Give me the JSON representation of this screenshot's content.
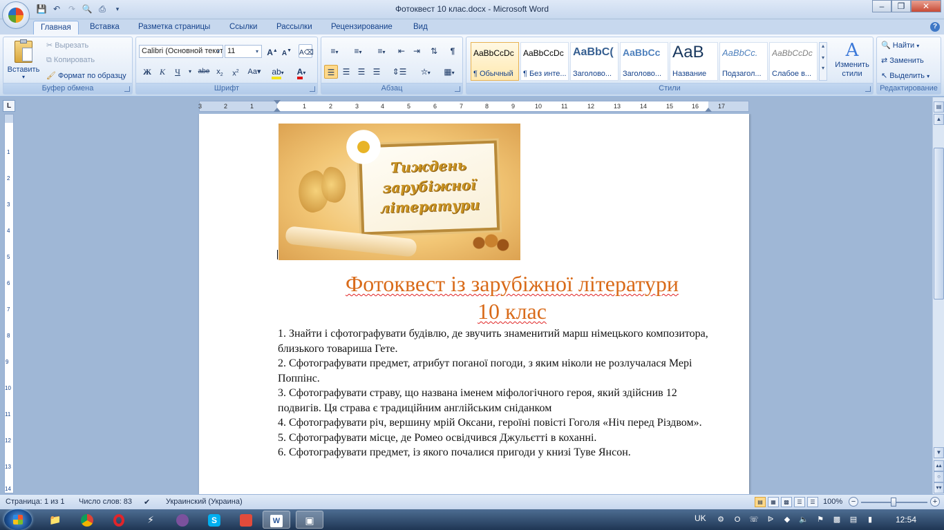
{
  "window": {
    "title": "Фотоквест 10 клас.docx - Microsoft Word"
  },
  "tabs": [
    "Главная",
    "Вставка",
    "Разметка страницы",
    "Ссылки",
    "Рассылки",
    "Рецензирование",
    "Вид"
  ],
  "clipboard": {
    "group": "Буфер обмена",
    "paste": "Вставить",
    "cut": "Вырезать",
    "copy": "Копировать",
    "format_painter": "Формат по образцу"
  },
  "font": {
    "group": "Шрифт",
    "name": "Calibri (Основной текст)",
    "size": "11"
  },
  "paragraph": {
    "group": "Абзац"
  },
  "styles": {
    "group": "Стили",
    "change_styles": "Изменить стили",
    "items": [
      {
        "sample": "AaBbCcDc",
        "name": "¶ Обычный"
      },
      {
        "sample": "AaBbCcDc",
        "name": "¶ Без инте..."
      },
      {
        "sample": "AaBbC(",
        "name": "Заголово..."
      },
      {
        "sample": "AaBbCc",
        "name": "Заголово..."
      },
      {
        "sample": "АаВ",
        "name": "Название"
      },
      {
        "sample": "AaBbCc.",
        "name": "Подзагол..."
      },
      {
        "sample": "AaBbCcDc",
        "name": "Слабое в..."
      }
    ]
  },
  "editing": {
    "group": "Редактирование",
    "find": "Найти",
    "replace": "Заменить",
    "select": "Выделить"
  },
  "ruler": {
    "labels": [
      "3",
      "2",
      "1",
      "1",
      "2",
      "3",
      "4",
      "5",
      "6",
      "7",
      "8",
      "9",
      "10",
      "11",
      "12",
      "13",
      "14",
      "15",
      "16",
      "17"
    ]
  },
  "vruler": {
    "labels": [
      "1",
      "2",
      "3",
      "4",
      "5",
      "6",
      "7",
      "8",
      "9",
      "10",
      "11",
      "12",
      "13",
      "14"
    ]
  },
  "document": {
    "banner_text": [
      "Тиждень",
      "зарубіжної",
      "літератури"
    ],
    "title_line1": "Фотоквест із зарубіжної літератури",
    "title_line2": "10 клас",
    "tasks": [
      "1. Знайти і сфотографувати будівлю, де звучить знаменитий марш німецького композитора, близького товариша Гете.",
      "2. Сфотографувати предмет, атрибут поганої погоди, з яким ніколи не розлучалася Мері Поппінс.",
      "3. Сфотографувати страву, що названа іменем міфологічного героя, який здійснив 12 подвигів. Ця страва є традиційним англійським сніданком",
      "4. Сфотографувати річ, вершину мрій Оксани, героїні повісті Гоголя «Ніч перед Різдвом».",
      "5. Сфотографувати місце, де Ромео освідчився Джульєтті в коханні.",
      "6. Сфотографувати предмет, із якого почалися пригоди у книзі Туве Янсон."
    ]
  },
  "status": {
    "page": "Страница: 1 из 1",
    "words": "Число слов: 83",
    "language": "Украинский (Украина)",
    "zoom": "100%"
  },
  "taskbar": {
    "lang": "UK",
    "time": "12:54"
  }
}
